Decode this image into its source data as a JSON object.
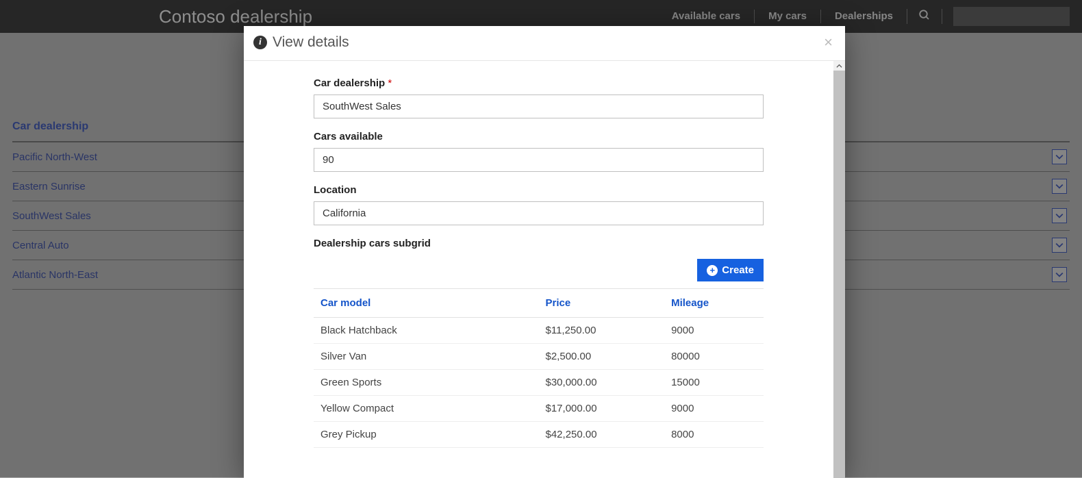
{
  "header": {
    "brand": "Contoso dealership",
    "nav": [
      {
        "label": "Available cars"
      },
      {
        "label": "My cars"
      },
      {
        "label": "Dealerships"
      }
    ]
  },
  "page": {
    "heading": "Car dealership",
    "rows": [
      {
        "name": "Pacific North-West"
      },
      {
        "name": "Eastern Sunrise"
      },
      {
        "name": "SouthWest Sales"
      },
      {
        "name": "Central Auto"
      },
      {
        "name": "Atlantic North-East"
      }
    ]
  },
  "modal": {
    "title": "View details",
    "fields": {
      "dealership": {
        "label": "Car dealership",
        "required": "*",
        "value": "SouthWest Sales"
      },
      "cars_available": {
        "label": "Cars available",
        "value": "90"
      },
      "location": {
        "label": "Location",
        "value": "California"
      }
    },
    "subgrid": {
      "title": "Dealership cars subgrid",
      "create_label": "Create",
      "columns": {
        "model": "Car model",
        "price": "Price",
        "mileage": "Mileage"
      },
      "rows": [
        {
          "model": "Black Hatchback",
          "price": "$11,250.00",
          "mileage": "9000"
        },
        {
          "model": "Silver Van",
          "price": "$2,500.00",
          "mileage": "80000"
        },
        {
          "model": "Green Sports",
          "price": "$30,000.00",
          "mileage": "15000"
        },
        {
          "model": "Yellow Compact",
          "price": "$17,000.00",
          "mileage": "9000"
        },
        {
          "model": "Grey Pickup",
          "price": "$42,250.00",
          "mileage": "8000"
        }
      ]
    }
  }
}
